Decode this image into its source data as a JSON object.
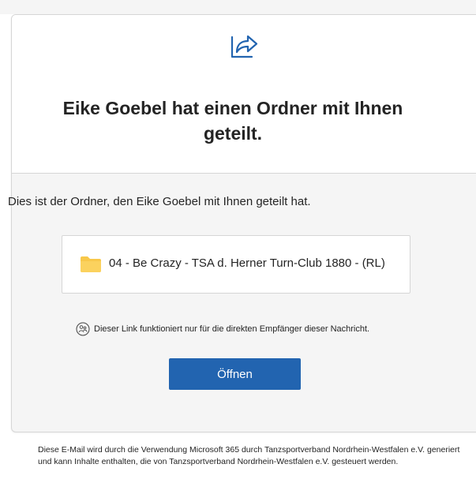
{
  "header": {
    "title": "Eike Goebel hat einen Ordner mit Ihnen geteilt.",
    "icon": "share-icon"
  },
  "body": {
    "intro": "Dies ist der Ordner, den Eike Goebel mit Ihnen geteilt hat.",
    "folder": {
      "icon": "folder-icon",
      "name": "04 - Be Crazy - TSA d. Herner Turn-Club 1880 - (RL)"
    },
    "notice": {
      "icon": "people-icon",
      "text": "Dieser Link funktioniert nur für die direkten Empfänger dieser Nachricht."
    },
    "open_button_label": "Öffnen"
  },
  "footer": {
    "text": "Diese E-Mail wird durch die Verwendung Microsoft 365 durch Tanzsportverband Nordrhein-Westfalen e.V. generiert und kann Inhalte enthalten, die von Tanzsportverband Nordrhein-Westfalen e.V. gesteuert werden."
  },
  "colors": {
    "accent": "#2264b0",
    "folder": "#f8c84a",
    "background_panel": "#f5f5f5",
    "border": "#d6d6d6"
  }
}
